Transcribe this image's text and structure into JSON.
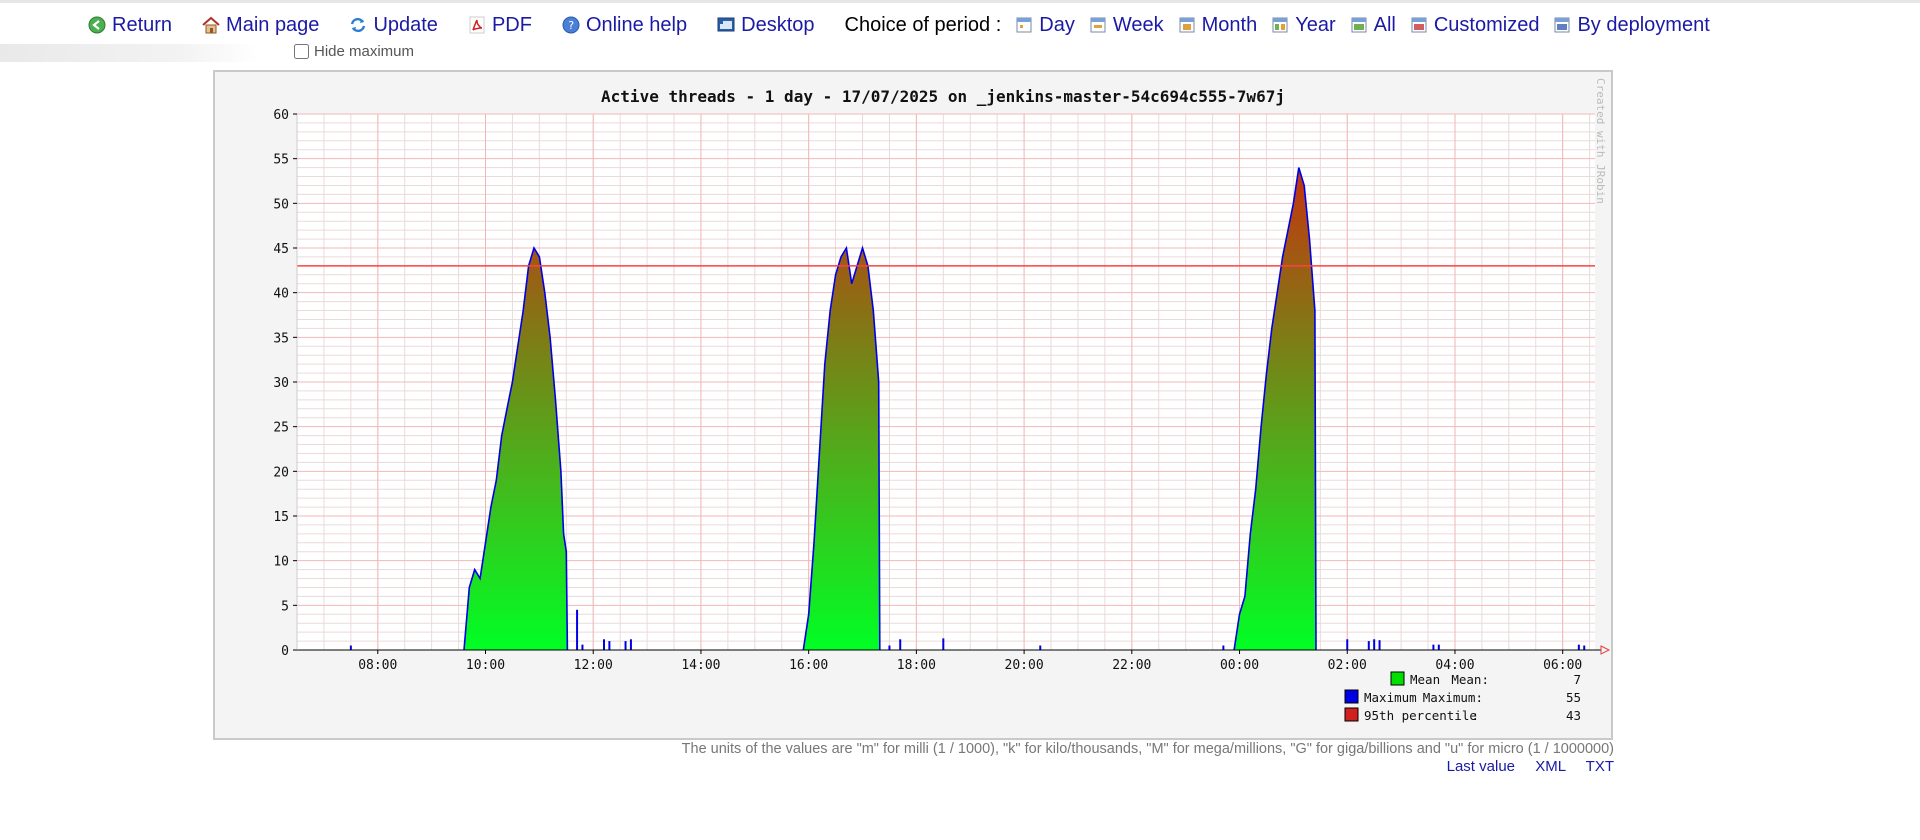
{
  "toolbar": {
    "return_label": "Return",
    "main_page_label": "Main page",
    "update_label": "Update",
    "pdf_label": "PDF",
    "help_label": "Online help",
    "desktop_label": "Desktop",
    "period_label": "Choice of period :",
    "periods": [
      "Day",
      "Week",
      "Month",
      "Year",
      "All",
      "Customized",
      "By deployment"
    ]
  },
  "hide_max_label": "Hide maximum",
  "hide_max_checked": false,
  "units_note": "The units of the values are \"m\" for milli (1 / 1000), \"k\" for kilo/thousands, \"M\" for mega/millions, \"G\" for giga/billions and \"u\" for micro (1 / 1000000)",
  "footer_links": [
    "Last value",
    "XML",
    "TXT"
  ],
  "chart_data": {
    "type": "area",
    "title": "Active threads - 1 day - 17/07/2025 on _jenkins-master-54c694c555-7w67j",
    "watermark": "Created with JRobin",
    "xlabel": "",
    "ylabel": "",
    "ylim": [
      0,
      60
    ],
    "yticks": [
      0,
      5,
      10,
      15,
      20,
      25,
      30,
      35,
      40,
      45,
      50,
      55,
      60
    ],
    "xlim": [
      6.5,
      30.6
    ],
    "xticks": [
      {
        "h": 8,
        "label": "08:00"
      },
      {
        "h": 10,
        "label": "10:00"
      },
      {
        "h": 12,
        "label": "12:00"
      },
      {
        "h": 14,
        "label": "14:00"
      },
      {
        "h": 16,
        "label": "16:00"
      },
      {
        "h": 18,
        "label": "18:00"
      },
      {
        "h": 20,
        "label": "20:00"
      },
      {
        "h": 22,
        "label": "22:00"
      },
      {
        "h": 24,
        "label": "00:00"
      },
      {
        "h": 26,
        "label": "02:00"
      },
      {
        "h": 28,
        "label": "04:00"
      },
      {
        "h": 30,
        "label": "06:00"
      }
    ],
    "grid": true,
    "percentile_95": 43,
    "peaks": [
      {
        "name": "mean",
        "points": [
          [
            9.6,
            0
          ],
          [
            9.7,
            7
          ],
          [
            9.8,
            9
          ],
          [
            9.9,
            8
          ],
          [
            10.0,
            12
          ],
          [
            10.1,
            16
          ],
          [
            10.2,
            19
          ],
          [
            10.3,
            24
          ],
          [
            10.4,
            27
          ],
          [
            10.5,
            30
          ],
          [
            10.6,
            34
          ],
          [
            10.7,
            38
          ],
          [
            10.8,
            43
          ],
          [
            10.9,
            45
          ],
          [
            11.0,
            44
          ],
          [
            11.1,
            40
          ],
          [
            11.2,
            35
          ],
          [
            11.3,
            28
          ],
          [
            11.4,
            20
          ],
          [
            11.45,
            13
          ],
          [
            11.5,
            11
          ],
          [
            11.52,
            0
          ]
        ]
      },
      {
        "name": "mean",
        "points": [
          [
            15.9,
            0
          ],
          [
            16.0,
            4
          ],
          [
            16.1,
            12
          ],
          [
            16.2,
            22
          ],
          [
            16.3,
            32
          ],
          [
            16.4,
            38
          ],
          [
            16.5,
            42
          ],
          [
            16.6,
            44
          ],
          [
            16.7,
            45
          ],
          [
            16.8,
            41
          ],
          [
            16.9,
            43
          ],
          [
            17.0,
            45
          ],
          [
            17.1,
            43
          ],
          [
            17.2,
            38
          ],
          [
            17.3,
            30
          ],
          [
            17.32,
            0
          ]
        ]
      },
      {
        "name": "mean",
        "points": [
          [
            23.9,
            0
          ],
          [
            24.0,
            4
          ],
          [
            24.1,
            6
          ],
          [
            24.2,
            13
          ],
          [
            24.3,
            18
          ],
          [
            24.4,
            25
          ],
          [
            24.5,
            31
          ],
          [
            24.6,
            36
          ],
          [
            24.7,
            40
          ],
          [
            24.8,
            44
          ],
          [
            24.9,
            47
          ],
          [
            25.0,
            50
          ],
          [
            25.1,
            54
          ],
          [
            25.2,
            52
          ],
          [
            25.3,
            46
          ],
          [
            25.4,
            38
          ],
          [
            25.42,
            0
          ]
        ]
      }
    ],
    "small_spikes": [
      {
        "x": 7.5,
        "y": 0.5
      },
      {
        "x": 11.7,
        "y": 4.5
      },
      {
        "x": 11.8,
        "y": 0.6
      },
      {
        "x": 12.2,
        "y": 1.2
      },
      {
        "x": 12.3,
        "y": 1.0
      },
      {
        "x": 12.6,
        "y": 1.0
      },
      {
        "x": 12.7,
        "y": 1.2
      },
      {
        "x": 17.5,
        "y": 0.5
      },
      {
        "x": 17.7,
        "y": 1.2
      },
      {
        "x": 18.5,
        "y": 1.3
      },
      {
        "x": 20.3,
        "y": 0.5
      },
      {
        "x": 23.7,
        "y": 0.5
      },
      {
        "x": 26.0,
        "y": 1.2
      },
      {
        "x": 26.4,
        "y": 1.0
      },
      {
        "x": 26.5,
        "y": 1.2
      },
      {
        "x": 26.6,
        "y": 1.1
      },
      {
        "x": 27.6,
        "y": 0.6
      },
      {
        "x": 27.7,
        "y": 0.6
      },
      {
        "x": 30.3,
        "y": 0.6
      },
      {
        "x": 30.4,
        "y": 0.5
      }
    ],
    "legend": [
      {
        "swatch": "#00e000",
        "label": "Mean",
        "sublabel": "Mean:",
        "value": "7"
      },
      {
        "swatch": "#0000e6",
        "label": "Maximum",
        "sublabel": "Maximum:",
        "value": "55"
      },
      {
        "swatch": "#d02020",
        "label": "95th percentile",
        "sublabel": ":",
        "value": "43"
      }
    ],
    "colors": {
      "max_line": "#0000e6",
      "fill_top": "#c8300e",
      "fill_bottom": "#00ff24",
      "percentile_line": "#ff4040"
    }
  }
}
